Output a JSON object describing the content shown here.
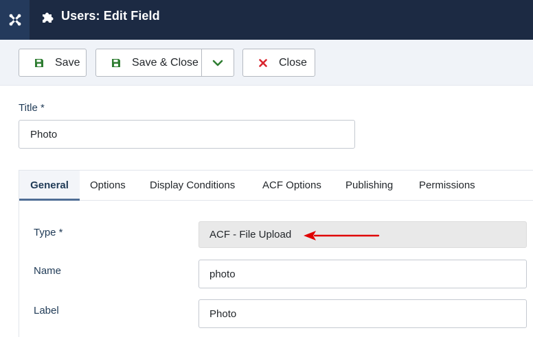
{
  "header": {
    "logo_icon": "joomla-logo-icon",
    "title_icon": "puzzle-piece-icon",
    "title": "Users: Edit Field"
  },
  "toolbar": {
    "save_label": "Save",
    "save_icon": "floppy-disk-icon",
    "save_close_label": "Save & Close",
    "save_close_icon": "floppy-disk-icon",
    "dropdown_icon": "chevron-down-icon",
    "close_label": "Close",
    "close_icon": "x-icon"
  },
  "title_field": {
    "label": "Title *",
    "value": "Photo"
  },
  "tabs": [
    {
      "label": "General",
      "active": true
    },
    {
      "label": "Options"
    },
    {
      "label": "Display Conditions"
    },
    {
      "label": "ACF Options"
    },
    {
      "label": "Publishing"
    },
    {
      "label": "Permissions"
    }
  ],
  "form": {
    "type_label": "Type *",
    "type_value": "ACF - File Upload",
    "name_label": "Name",
    "name_value": "photo",
    "label_label": "Label",
    "label_value": "Photo"
  },
  "colors": {
    "header_bg": "#1c2a43",
    "save_icon": "#2f7d32",
    "close_icon": "#d9262f",
    "arrow": "#e00000"
  }
}
